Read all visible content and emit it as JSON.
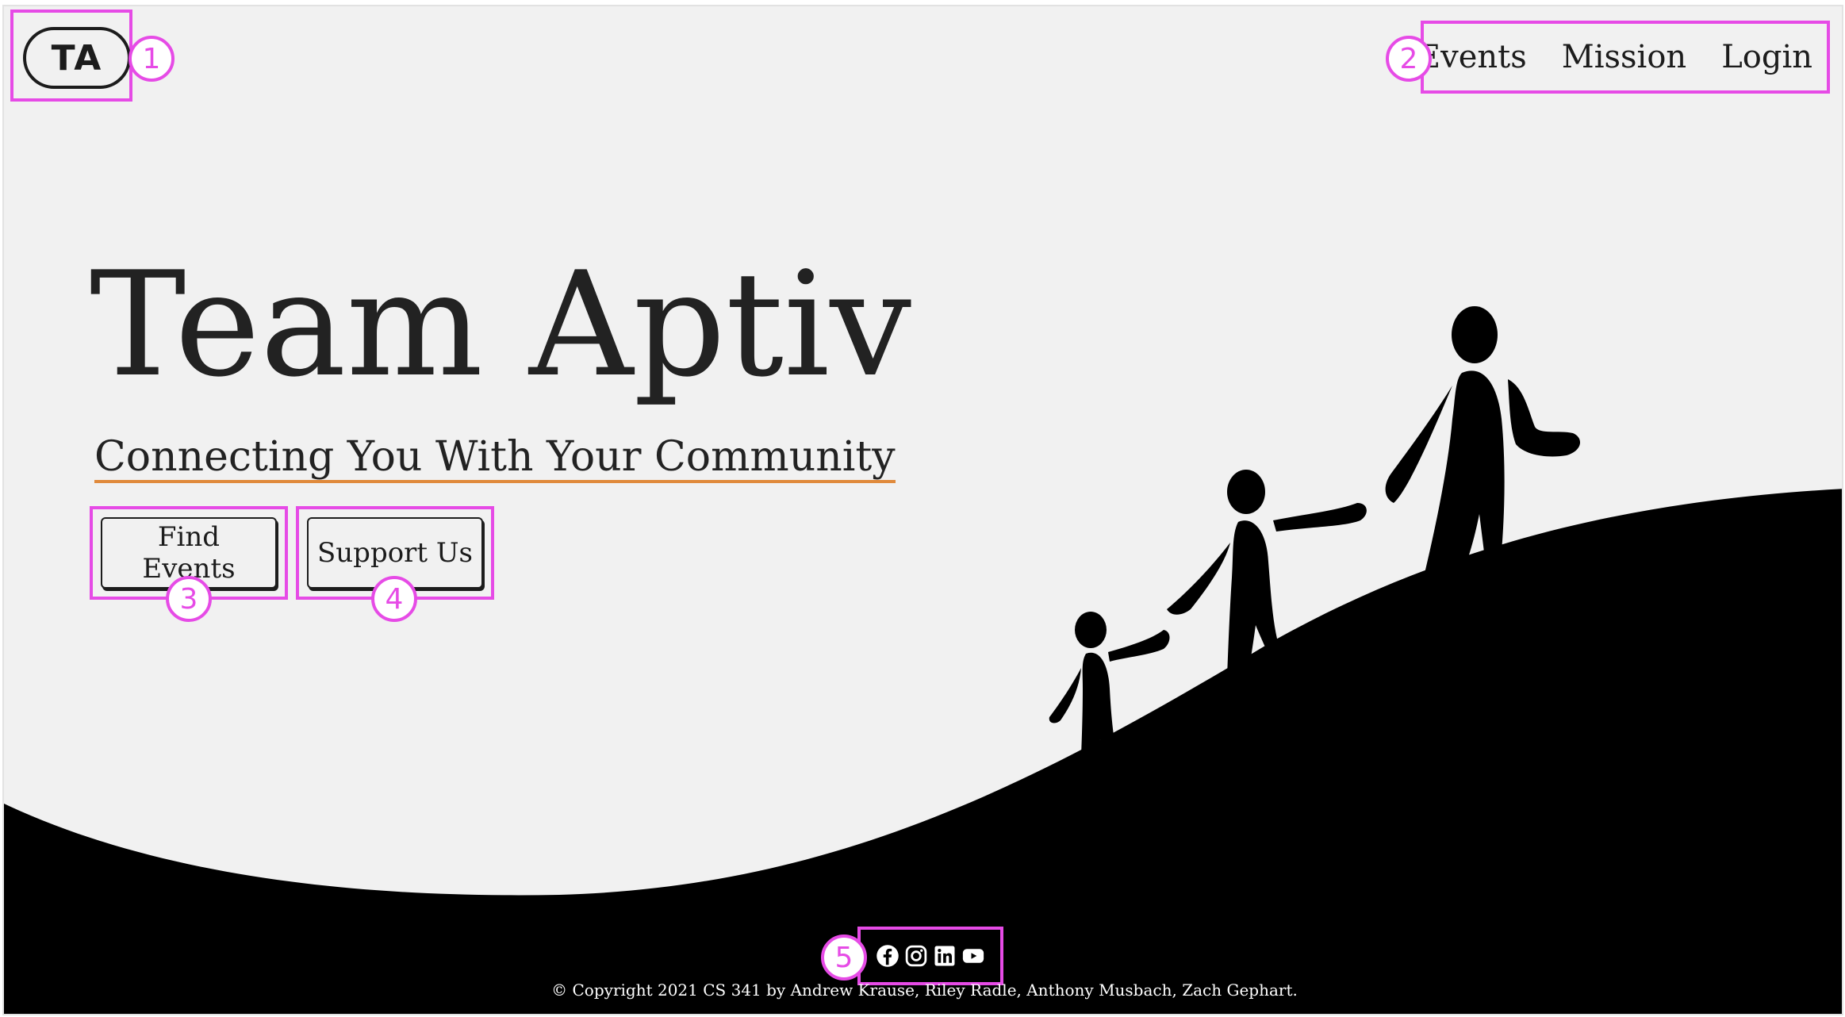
{
  "brand": {
    "logo_text": "TA"
  },
  "nav": {
    "links": [
      "Events",
      "Mission",
      "Login"
    ]
  },
  "hero": {
    "title": "Team Aptiv",
    "subtitle": "Connecting You With Your Community",
    "primary_button": "Find Events",
    "secondary_button": "Support Us"
  },
  "illustration": {
    "description_icon": "family-walking-uphill-silhouette"
  },
  "footer": {
    "social_icons": [
      "facebook-icon",
      "instagram-icon",
      "linkedin-icon",
      "youtube-icon"
    ],
    "copyright": "© Copyright 2021 CS 341 by Andrew Krause, Riley Radle, Anthony Musbach, Zach Gephart."
  },
  "annotations": {
    "labels": [
      "1",
      "2",
      "3",
      "4",
      "5"
    ]
  },
  "colors": {
    "background": "#f1f1f1",
    "text": "#222222",
    "accent_underline": "#e08a3c",
    "annotation": "#e64be6",
    "hill": "#000000"
  }
}
